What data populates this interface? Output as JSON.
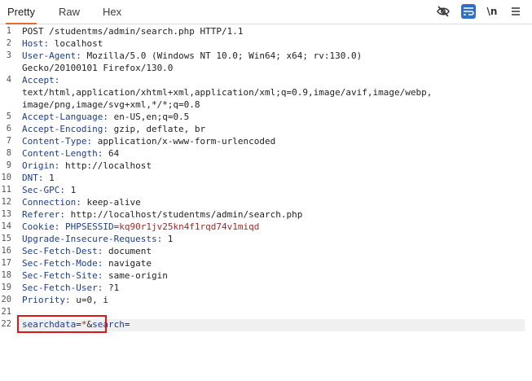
{
  "tabs": [
    {
      "label": "Pretty",
      "active": true
    },
    {
      "label": "Raw",
      "active": false
    },
    {
      "label": "Hex",
      "active": false
    }
  ],
  "toolbar": {
    "icons": [
      "eye-off-icon",
      "word-wrap-icon",
      "newline-toggle-icon",
      "hamburger-menu-icon"
    ],
    "newline_label": "\\n"
  },
  "colors": {
    "accent": "#e8672d",
    "header_name": "#1d3d8c",
    "cookie_value": "#a12a2a",
    "highlight_border": "#e01616",
    "wrap_button": "#2f6fc4"
  },
  "request": {
    "line_numbers": [
      "1",
      "2",
      "3",
      "4",
      "5",
      "6",
      "7",
      "8",
      "9",
      "10",
      "11",
      "12",
      "13",
      "14",
      "15",
      "16",
      "17",
      "18",
      "19",
      "20",
      "21",
      "22"
    ],
    "request_line": "POST /studentms/admin/search.php HTTP/1.1",
    "host_name": "Host:",
    "host_value": " localhost",
    "ua_name": "User-Agent:",
    "ua_value": " Mozilla/5.0 (Windows NT 10.0; Win64; x64; rv:130.0)",
    "ua_cont": "Gecko/20100101 Firefox/130.0",
    "accept_name": "Accept:",
    "accept_cont1": "text/html,application/xhtml+xml,application/xml;q=0.9,image/avif,image/webp,",
    "accept_cont2": "image/png,image/svg+xml,*/*;q=0.8",
    "al_name": "Accept-Language:",
    "al_value": " en-US,en;q=0.5",
    "ae_name": "Accept-Encoding:",
    "ae_value": " gzip, deflate, br",
    "ct_name": "Content-Type:",
    "ct_value": " application/x-www-form-urlencoded",
    "cl_name": "Content-Length:",
    "cl_value": " 64",
    "origin_name": "Origin:",
    "origin_value": " http://localhost",
    "dnt_name": "DNT:",
    "dnt_value": " 1",
    "gpc_name": "Sec-GPC:",
    "gpc_value": " 1",
    "conn_name": "Connection:",
    "conn_value": " keep-alive",
    "ref_name": "Referer:",
    "ref_value": " http://localhost/studentms/admin/search.php",
    "cookie_name": "Cookie:",
    "cookie_key": " PHPSESSID=",
    "cookie_value": "kq90r1jv25kn4f1rqd74v1miqd",
    "uir_name": "Upgrade-Insecure-Requests:",
    "uir_value": " 1",
    "sfd_name": "Sec-Fetch-Dest:",
    "sfd_value": " document",
    "sfm_name": "Sec-Fetch-Mode:",
    "sfm_value": " navigate",
    "sfs_name": "Sec-Fetch-Site:",
    "sfs_value": " same-origin",
    "sfu_name": "Sec-Fetch-User:",
    "sfu_value": " ?1",
    "prio_name": "Priority:",
    "prio_value": " u=0, i",
    "body_key1": "searchdata",
    "body_eq1": "=",
    "body_val1": "*",
    "body_amp": "&",
    "body_key2": "search",
    "body_eq2": "="
  }
}
